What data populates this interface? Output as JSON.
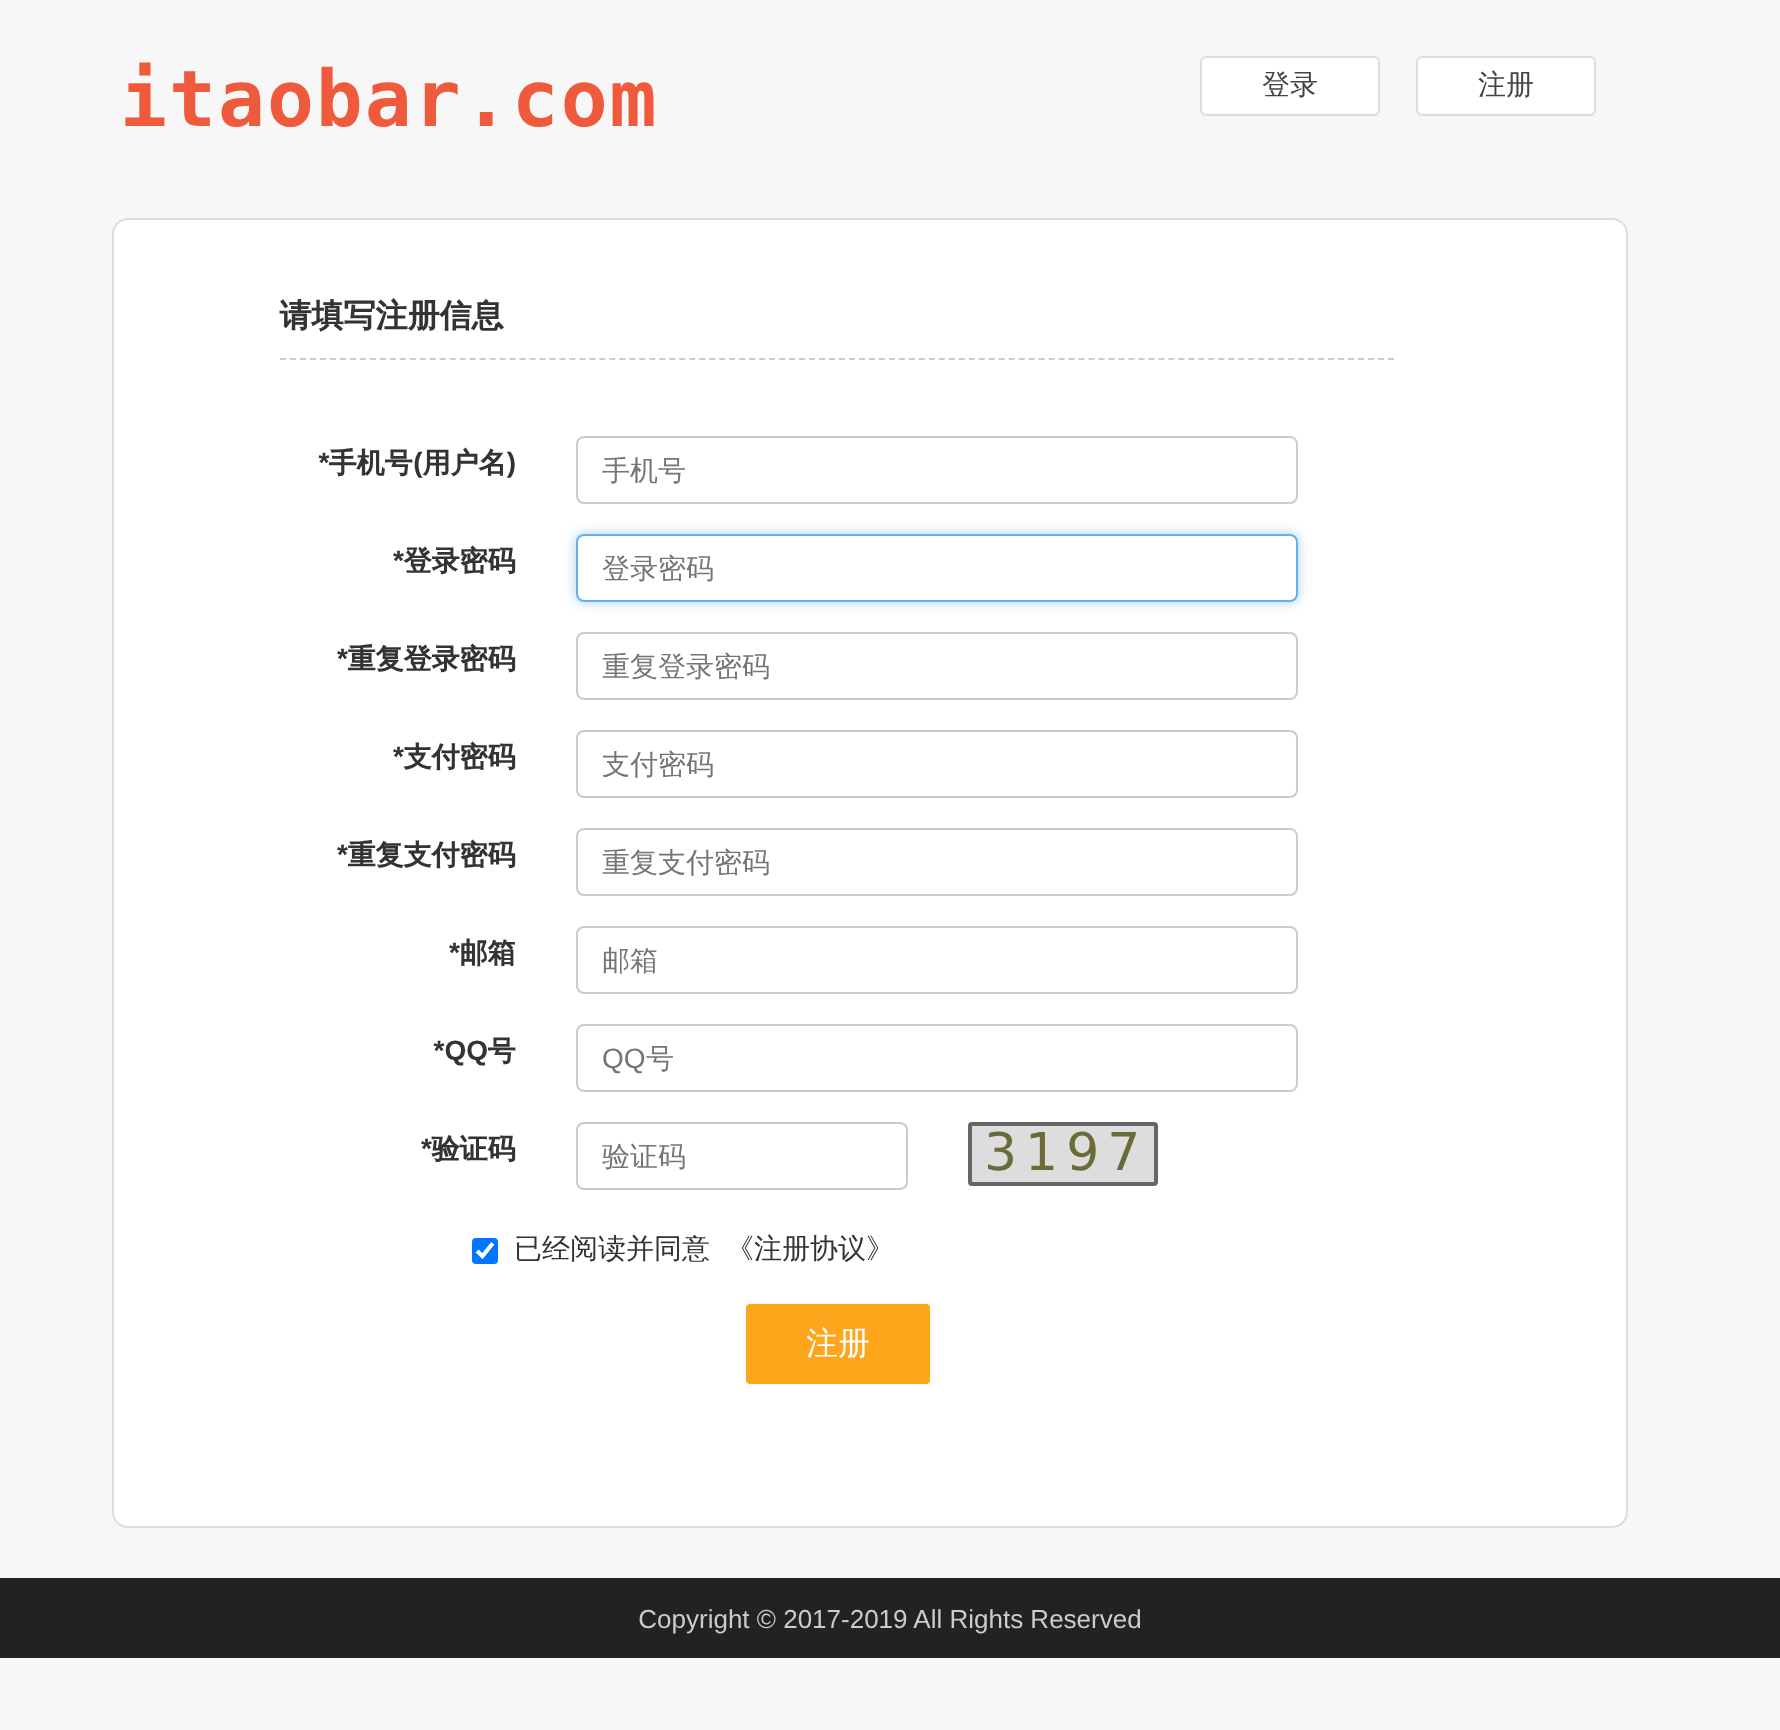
{
  "header": {
    "logo": "itaobar.com",
    "buttons": [
      "登录",
      "注册"
    ]
  },
  "form": {
    "title": "请填写注册信息",
    "fields": [
      {
        "label": "*手机号(用户名)",
        "placeholder": "手机号",
        "focused": false,
        "kind": "text"
      },
      {
        "label": "*登录密码",
        "placeholder": "登录密码",
        "focused": true,
        "kind": "text"
      },
      {
        "label": "*重复登录密码",
        "placeholder": "重复登录密码",
        "focused": false,
        "kind": "text"
      },
      {
        "label": "*支付密码",
        "placeholder": "支付密码",
        "focused": false,
        "kind": "text"
      },
      {
        "label": "*重复支付密码",
        "placeholder": "重复支付密码",
        "focused": false,
        "kind": "text"
      },
      {
        "label": "*邮箱",
        "placeholder": "邮箱",
        "focused": false,
        "kind": "text"
      },
      {
        "label": "*QQ号",
        "placeholder": "QQ号",
        "focused": false,
        "kind": "text"
      },
      {
        "label": "*验证码",
        "placeholder": "验证码",
        "focused": false,
        "kind": "captcha",
        "captcha": "3197"
      }
    ],
    "agreement": {
      "checked": true,
      "text": "已经阅读并同意",
      "link": "《注册协议》"
    },
    "submit": "注册"
  },
  "footer": {
    "copyright": "Copyright © 2017-2019 All Rights Reserved"
  }
}
